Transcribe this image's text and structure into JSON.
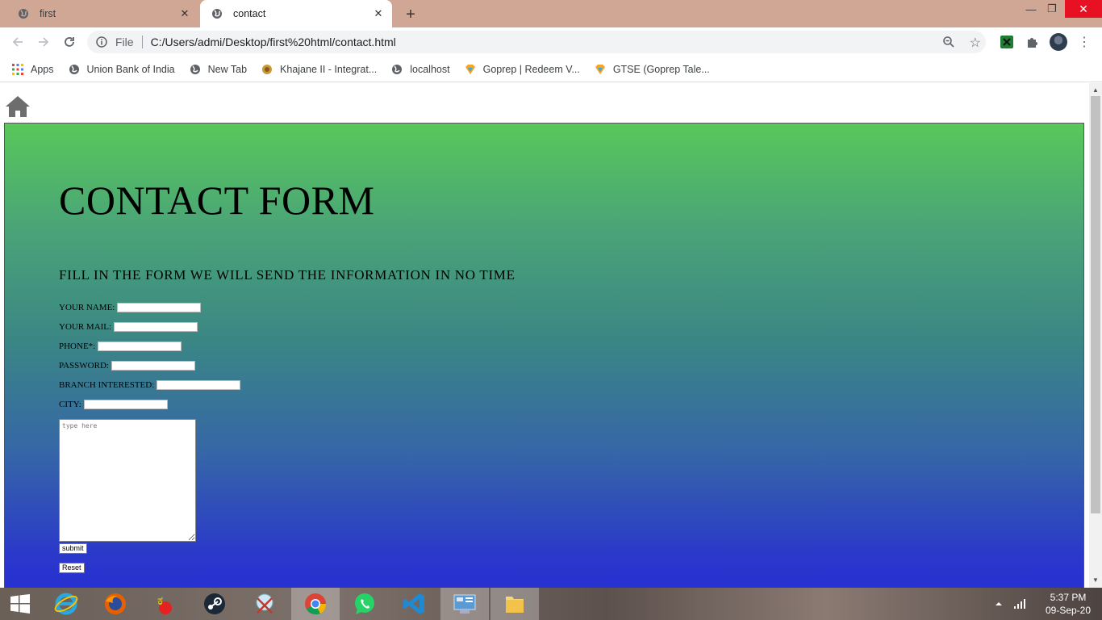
{
  "tabs": [
    {
      "title": "first",
      "active": false
    },
    {
      "title": "contact",
      "active": true
    }
  ],
  "address": {
    "scheme": "File",
    "url": "C:/Users/admi/Desktop/first%20html/contact.html"
  },
  "bookmarks": [
    "Apps",
    "Union Bank of India",
    "New Tab",
    "Khajane II - Integrat...",
    "localhost",
    "Goprep | Redeem V...",
    "GTSE (Goprep Tale..."
  ],
  "page": {
    "title": "CONTACT FORM",
    "subheading": "FILL IN THE FORM WE WILL SEND THE INFORMATION IN NO TIME",
    "fields": [
      {
        "label": "YOUR NAME:",
        "value": ""
      },
      {
        "label": "YOUR MAIL:",
        "value": ""
      },
      {
        "label": "PHONE*:",
        "value": ""
      },
      {
        "label": "PASSWORD:",
        "value": ""
      },
      {
        "label": "BRANCH INTERESTED:",
        "value": ""
      },
      {
        "label": "CITY:",
        "value": ""
      }
    ],
    "message_placeholder": "type here",
    "submit_label": "submit",
    "reset_label": "Reset"
  },
  "clock": {
    "time": "5:37 PM",
    "date": "09-Sep-20"
  },
  "colors": {
    "tabstrip": "#cfa794",
    "gradient_top": "#58c85a",
    "gradient_bottom": "#2630d2",
    "close_red": "#e81123"
  },
  "icons": [
    "globe-icon",
    "close-icon",
    "plus-icon",
    "minimize-icon",
    "restore-icon",
    "back-arrow-icon",
    "forward-arrow-icon",
    "reload-icon",
    "info-icon",
    "zoom-icon",
    "star-icon",
    "extension-icon",
    "puzzle-icon",
    "menu-icon",
    "apps-grid-icon",
    "home-icon",
    "windows-start-icon"
  ]
}
